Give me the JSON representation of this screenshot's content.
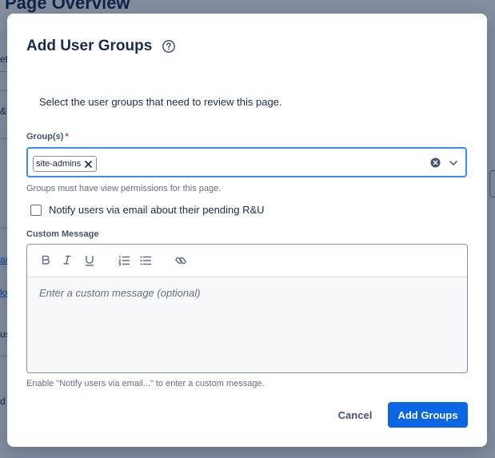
{
  "background": {
    "page_title": "Page Overview",
    "fragments": [
      "et",
      "&U",
      "ar",
      "lo",
      "us",
      "d"
    ]
  },
  "modal": {
    "title": "Add User Groups",
    "description": "Select the user groups that need to review this page.",
    "groups_field": {
      "label": "Group(s)",
      "required_marker": "*",
      "selected_tags": [
        "site-admins"
      ],
      "helper": "Groups must have view permissions for this page."
    },
    "notify_checkbox": {
      "label": "Notify users via email about their pending R&U",
      "checked": false
    },
    "custom_message": {
      "label": "Custom Message",
      "placeholder": "Enter a custom message (optional)",
      "toolbar": [
        "bold-icon",
        "italic-icon",
        "underline-icon",
        "numbered-list-icon",
        "bullet-list-icon",
        "link-icon"
      ],
      "helper": "Enable \"Notify users via email...\" to enter a custom message."
    },
    "buttons": {
      "cancel": "Cancel",
      "submit": "Add Groups"
    }
  },
  "colors": {
    "primary": "#0c66e4",
    "focus_border": "#388bff",
    "required": "#c9372c",
    "overlay": "rgba(9, 30, 66, 0.50)"
  }
}
